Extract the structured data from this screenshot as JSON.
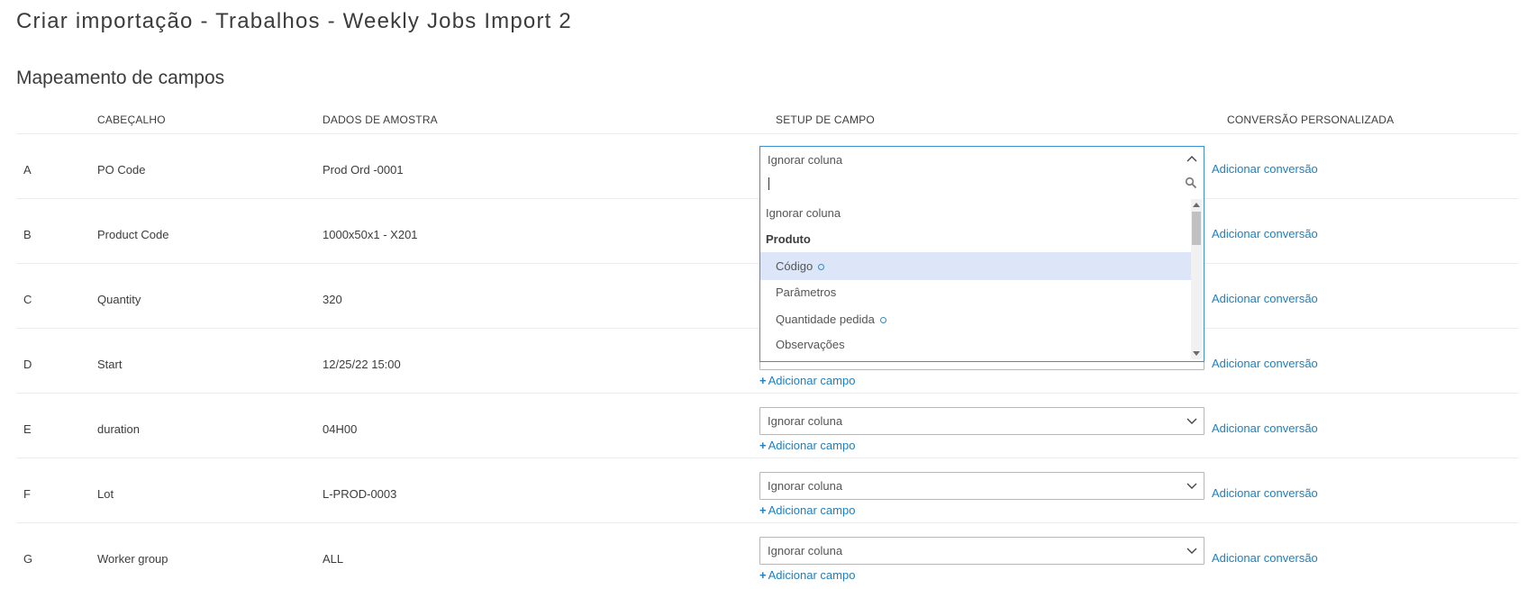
{
  "page_title": "Criar importação - Trabalhos - Weekly Jobs Import 2",
  "section_title": "Mapeamento de campos",
  "columns": {
    "header": "CABEÇALHO",
    "sample": "DADOS DE AMOSTRA",
    "setup": "SETUP DE CAMPO",
    "conversion": "CONVERSÃO PERSONALIZADA"
  },
  "rows": [
    {
      "letter": "A",
      "header": "PO Code",
      "sample": "Prod Ord -0001",
      "setup": "Ignorar coluna",
      "add_field": "",
      "add_conversion": "Adicionar conversão"
    },
    {
      "letter": "B",
      "header": "Product Code",
      "sample": "1000x50x1 - X201",
      "setup": "",
      "add_field": "",
      "add_conversion": "Adicionar conversão"
    },
    {
      "letter": "C",
      "header": "Quantity",
      "sample": "320",
      "setup": "",
      "add_field": "",
      "add_conversion": "Adicionar conversão"
    },
    {
      "letter": "D",
      "header": "Start",
      "sample": "12/25/22 15:00",
      "setup": "",
      "add_field": "Adicionar campo",
      "add_conversion": "Adicionar conversão"
    },
    {
      "letter": "E",
      "header": "duration",
      "sample": "04H00",
      "setup": "Ignorar coluna",
      "add_field": "Adicionar campo",
      "add_conversion": "Adicionar conversão"
    },
    {
      "letter": "F",
      "header": "Lot",
      "sample": "L-PROD-0003",
      "setup": "Ignorar coluna",
      "add_field": "Adicionar campo",
      "add_conversion": "Adicionar conversão"
    },
    {
      "letter": "G",
      "header": "Worker group",
      "sample": "ALL",
      "setup": "Ignorar coluna",
      "add_field": "Adicionar campo",
      "add_conversion": "Adicionar conversão"
    }
  ],
  "dropdown": {
    "selected": "Ignorar coluna",
    "search_value": "",
    "items": [
      {
        "label": "Ignorar coluna",
        "kind": "option",
        "highlighted": false,
        "required": false
      },
      {
        "label": "Produto",
        "kind": "group",
        "highlighted": false,
        "required": false
      },
      {
        "label": "Código",
        "kind": "suboption",
        "highlighted": true,
        "required": true
      },
      {
        "label": "Parâmetros",
        "kind": "suboption",
        "highlighted": false,
        "required": false
      },
      {
        "label": "Quantidade pedida",
        "kind": "suboption",
        "highlighted": false,
        "required": true
      },
      {
        "label": "Observações",
        "kind": "suboption",
        "highlighted": false,
        "required": false
      }
    ]
  },
  "colors": {
    "link": "#1e7fc1",
    "highlight": "#dde6f8",
    "focus_border": "#3d8ed1"
  }
}
